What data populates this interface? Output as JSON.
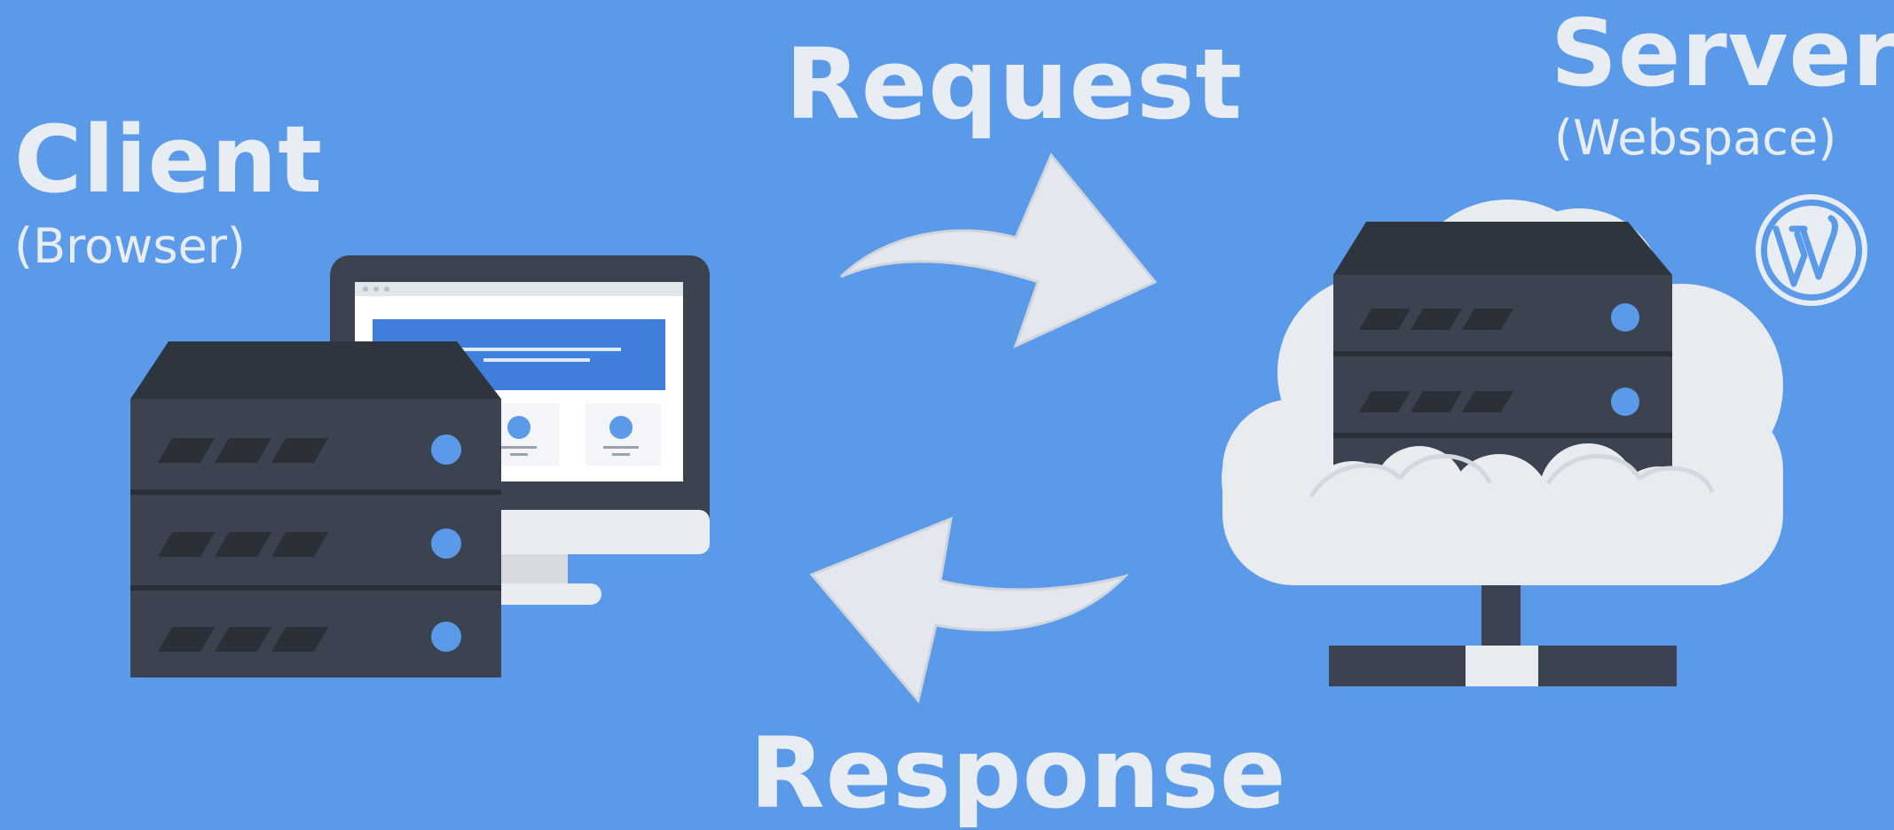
{
  "colors": {
    "background": "#5b9ae8",
    "text": "#e8edf3",
    "server_dark": "#3c4350",
    "server_top": "#2f353f",
    "led": "#5b9ae8",
    "cloud": "#e8ebef",
    "arrow": "#e4e8ee"
  },
  "client": {
    "title": "Client",
    "subtitle": "(Browser)"
  },
  "server": {
    "title": "Server",
    "subtitle": "(Webspace)"
  },
  "flow": {
    "request_label": "Request",
    "response_label": "Response"
  },
  "icons": [
    "client-server-rack-icon",
    "browser-monitor-icon",
    "cloud-server-icon",
    "network-connector-icon",
    "request-arrow-icon",
    "response-arrow-icon",
    "wordpress-logo-icon"
  ]
}
